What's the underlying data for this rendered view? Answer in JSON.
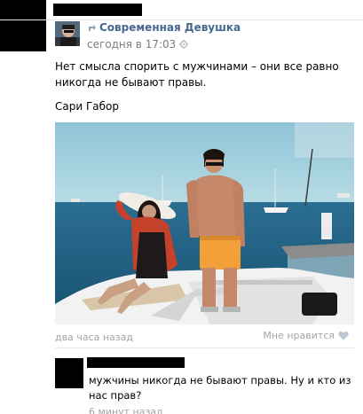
{
  "post": {
    "group_name": "Современная Девушка",
    "date": "сегодня в 17:03",
    "text": "Нет смысла спорить с мужчинами – они все равно никогда не бывают правы.",
    "author": "Сари Габор",
    "time_ago": "два часа назад",
    "like_label": "Мне нравится",
    "icons": {
      "repost": "repost-icon",
      "settings": "gear-icon",
      "like": "heart-icon"
    }
  },
  "comment": {
    "text": "мужчины никогда не бывают правы. Ну и кто из нас прав?",
    "time": "6 минут назад"
  },
  "colors": {
    "link": "#45688e",
    "meta": "#a3a3a3",
    "redaction": "#000000"
  }
}
